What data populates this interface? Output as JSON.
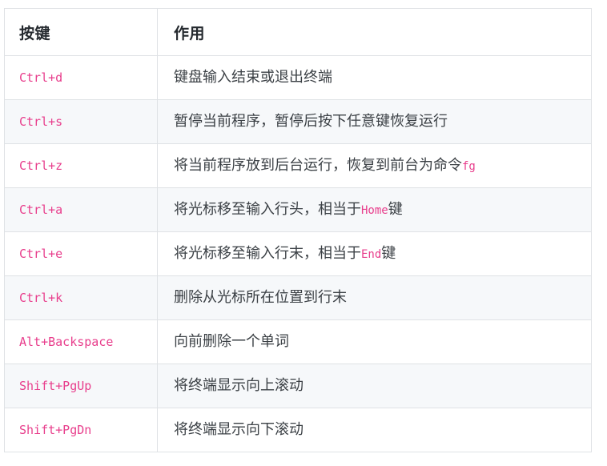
{
  "table": {
    "columns": [
      {
        "key": "key",
        "label": "按键"
      },
      {
        "key": "desc",
        "label": "作用"
      }
    ],
    "accent_code_color": "#e83e8c",
    "text_color": "#3b4045",
    "header_text_color": "#24292e",
    "border_color": "#dfe2e5",
    "row_alt_background": "#f6f8fa",
    "row_background": "#ffffff",
    "rows": [
      {
        "key": "Ctrl+d",
        "desc_prefix": "键盘输入结束或退出终端",
        "desc_code": "",
        "desc_suffix": "",
        "desc_full": "键盘输入结束或退出终端"
      },
      {
        "key": "Ctrl+s",
        "desc_prefix": "暂停当前程序，暂停后按下任意键恢复运行",
        "desc_code": "",
        "desc_suffix": "",
        "desc_full": "暂停当前程序，暂停后按下任意键恢复运行"
      },
      {
        "key": "Ctrl+z",
        "desc_prefix": "将当前程序放到后台运行，恢复到前台为命令",
        "desc_code": "fg",
        "desc_suffix": "",
        "desc_full": "将当前程序放到后台运行，恢复到前台为命令fg"
      },
      {
        "key": "Ctrl+a",
        "desc_prefix": "将光标移至输入行头，相当于",
        "desc_code": "Home",
        "desc_suffix": "键",
        "desc_full": "将光标移至输入行头，相当于Home键"
      },
      {
        "key": "Ctrl+e",
        "desc_prefix": "将光标移至输入行末，相当于",
        "desc_code": "End",
        "desc_suffix": "键",
        "desc_full": "将光标移至输入行末，相当于End键"
      },
      {
        "key": "Ctrl+k",
        "desc_prefix": "删除从光标所在位置到行末",
        "desc_code": "",
        "desc_suffix": "",
        "desc_full": "删除从光标所在位置到行末"
      },
      {
        "key": "Alt+Backspace",
        "desc_prefix": "向前删除一个单词",
        "desc_code": "",
        "desc_suffix": "",
        "desc_full": "向前删除一个单词"
      },
      {
        "key": "Shift+PgUp",
        "desc_prefix": "将终端显示向上滚动",
        "desc_code": "",
        "desc_suffix": "",
        "desc_full": "将终端显示向上滚动"
      },
      {
        "key": "Shift+PgDn",
        "desc_prefix": "将终端显示向下滚动",
        "desc_code": "",
        "desc_suffix": "",
        "desc_full": "将终端显示向下滚动"
      }
    ]
  }
}
